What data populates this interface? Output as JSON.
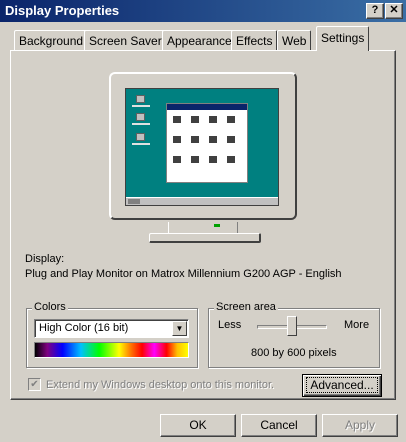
{
  "window": {
    "title": "Display Properties",
    "help_label": "?",
    "close_label": "✕"
  },
  "tabs": [
    {
      "label": "Background"
    },
    {
      "label": "Screen Saver"
    },
    {
      "label": "Appearance"
    },
    {
      "label": "Effects"
    },
    {
      "label": "Web"
    },
    {
      "label": "Settings",
      "active": true
    }
  ],
  "display": {
    "heading": "Display:",
    "device": "Plug and Play Monitor on Matrox Millennium G200 AGP - English"
  },
  "colors": {
    "legend": "Colors",
    "selected": "High Color (16 bit)"
  },
  "screen_area": {
    "legend": "Screen area",
    "less_label": "Less",
    "more_label": "More",
    "resolution": "800 by 600 pixels",
    "slider_level": 0.5
  },
  "extend_desktop": {
    "label": "Extend my Windows desktop onto this monitor.",
    "checked": true,
    "enabled": false
  },
  "buttons": {
    "advanced_label": "Advanced...",
    "ok_label": "OK",
    "cancel_label": "Cancel",
    "apply_label": "Apply"
  },
  "icons": {
    "dropdown": "chevron-down-icon",
    "check": "checkmark-icon"
  }
}
